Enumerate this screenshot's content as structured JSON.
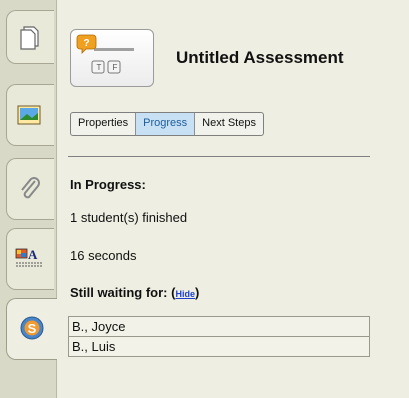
{
  "header": {
    "title": "Untitled Assessment",
    "icon": "true-false-assessment-icon",
    "icon_key_left": "T",
    "icon_key_right": "F"
  },
  "tabs": [
    {
      "label": "Properties",
      "selected": false
    },
    {
      "label": "Progress",
      "selected": true
    },
    {
      "label": "Next Steps",
      "selected": false
    }
  ],
  "progress": {
    "heading": "In Progress:",
    "finished_text": "1 student(s) finished",
    "elapsed_text": "16 seconds",
    "waiting_label": "Still waiting for:",
    "paren_open": "(",
    "hide_label": "Hide",
    "paren_close": ")"
  },
  "waiting": [
    "B., Joyce",
    "B., Luis"
  ],
  "sidebar_tabs": [
    {
      "icon": "page-icon"
    },
    {
      "icon": "image-icon"
    },
    {
      "icon": "paperclip-icon"
    },
    {
      "icon": "text-layout-icon"
    },
    {
      "icon": "assessment-s-icon",
      "active": true
    }
  ],
  "colors": {
    "background": "#eeeee2",
    "selected_tab": "#c7e0f4",
    "link": "#1c3fd0"
  }
}
